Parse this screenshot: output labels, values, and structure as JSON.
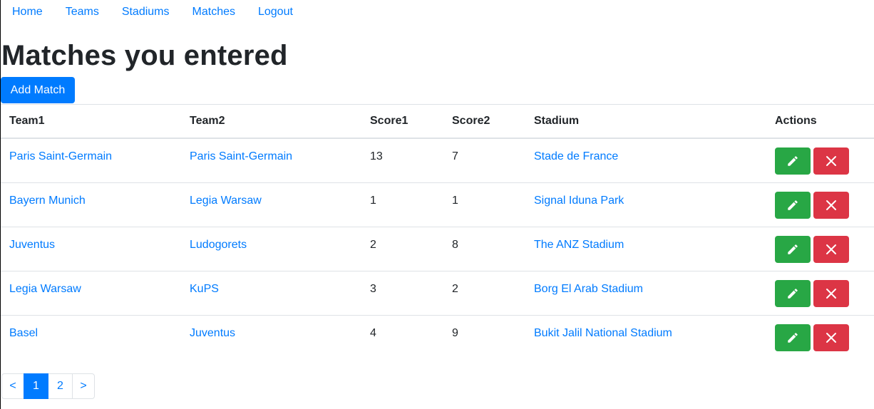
{
  "nav": {
    "items": [
      {
        "label": "Home"
      },
      {
        "label": "Teams"
      },
      {
        "label": "Stadiums"
      },
      {
        "label": "Matches"
      },
      {
        "label": "Logout"
      }
    ]
  },
  "page_title": "Matches you entered",
  "add_button_label": "Add Match",
  "table": {
    "headers": [
      "Team1",
      "Team2",
      "Score1",
      "Score2",
      "Stadium",
      "Actions"
    ],
    "rows": [
      {
        "team1": "Paris Saint-Germain",
        "team2": "Paris Saint-Germain",
        "score1": "13",
        "score2": "7",
        "stadium": "Stade de France"
      },
      {
        "team1": "Bayern Munich",
        "team2": "Legia Warsaw",
        "score1": "1",
        "score2": "1",
        "stadium": "Signal Iduna Park"
      },
      {
        "team1": "Juventus",
        "team2": "Ludogorets",
        "score1": "2",
        "score2": "8",
        "stadium": "The ANZ Stadium"
      },
      {
        "team1": "Legia Warsaw",
        "team2": "KuPS",
        "score1": "3",
        "score2": "2",
        "stadium": "Borg El Arab Stadium"
      },
      {
        "team1": "Basel",
        "team2": "Juventus",
        "score1": "4",
        "score2": "9",
        "stadium": "Bukit Jalil National Stadium"
      }
    ],
    "row_actions": {
      "edit_icon": "pencil-icon",
      "delete_icon": "close-icon"
    }
  },
  "pagination": {
    "prev": "<",
    "pages": [
      "1",
      "2"
    ],
    "current": "1",
    "next": ">"
  },
  "colors": {
    "primary": "#007bff",
    "success": "#28a745",
    "danger": "#dc3545",
    "border": "#dee2e6",
    "text": "#212529"
  }
}
